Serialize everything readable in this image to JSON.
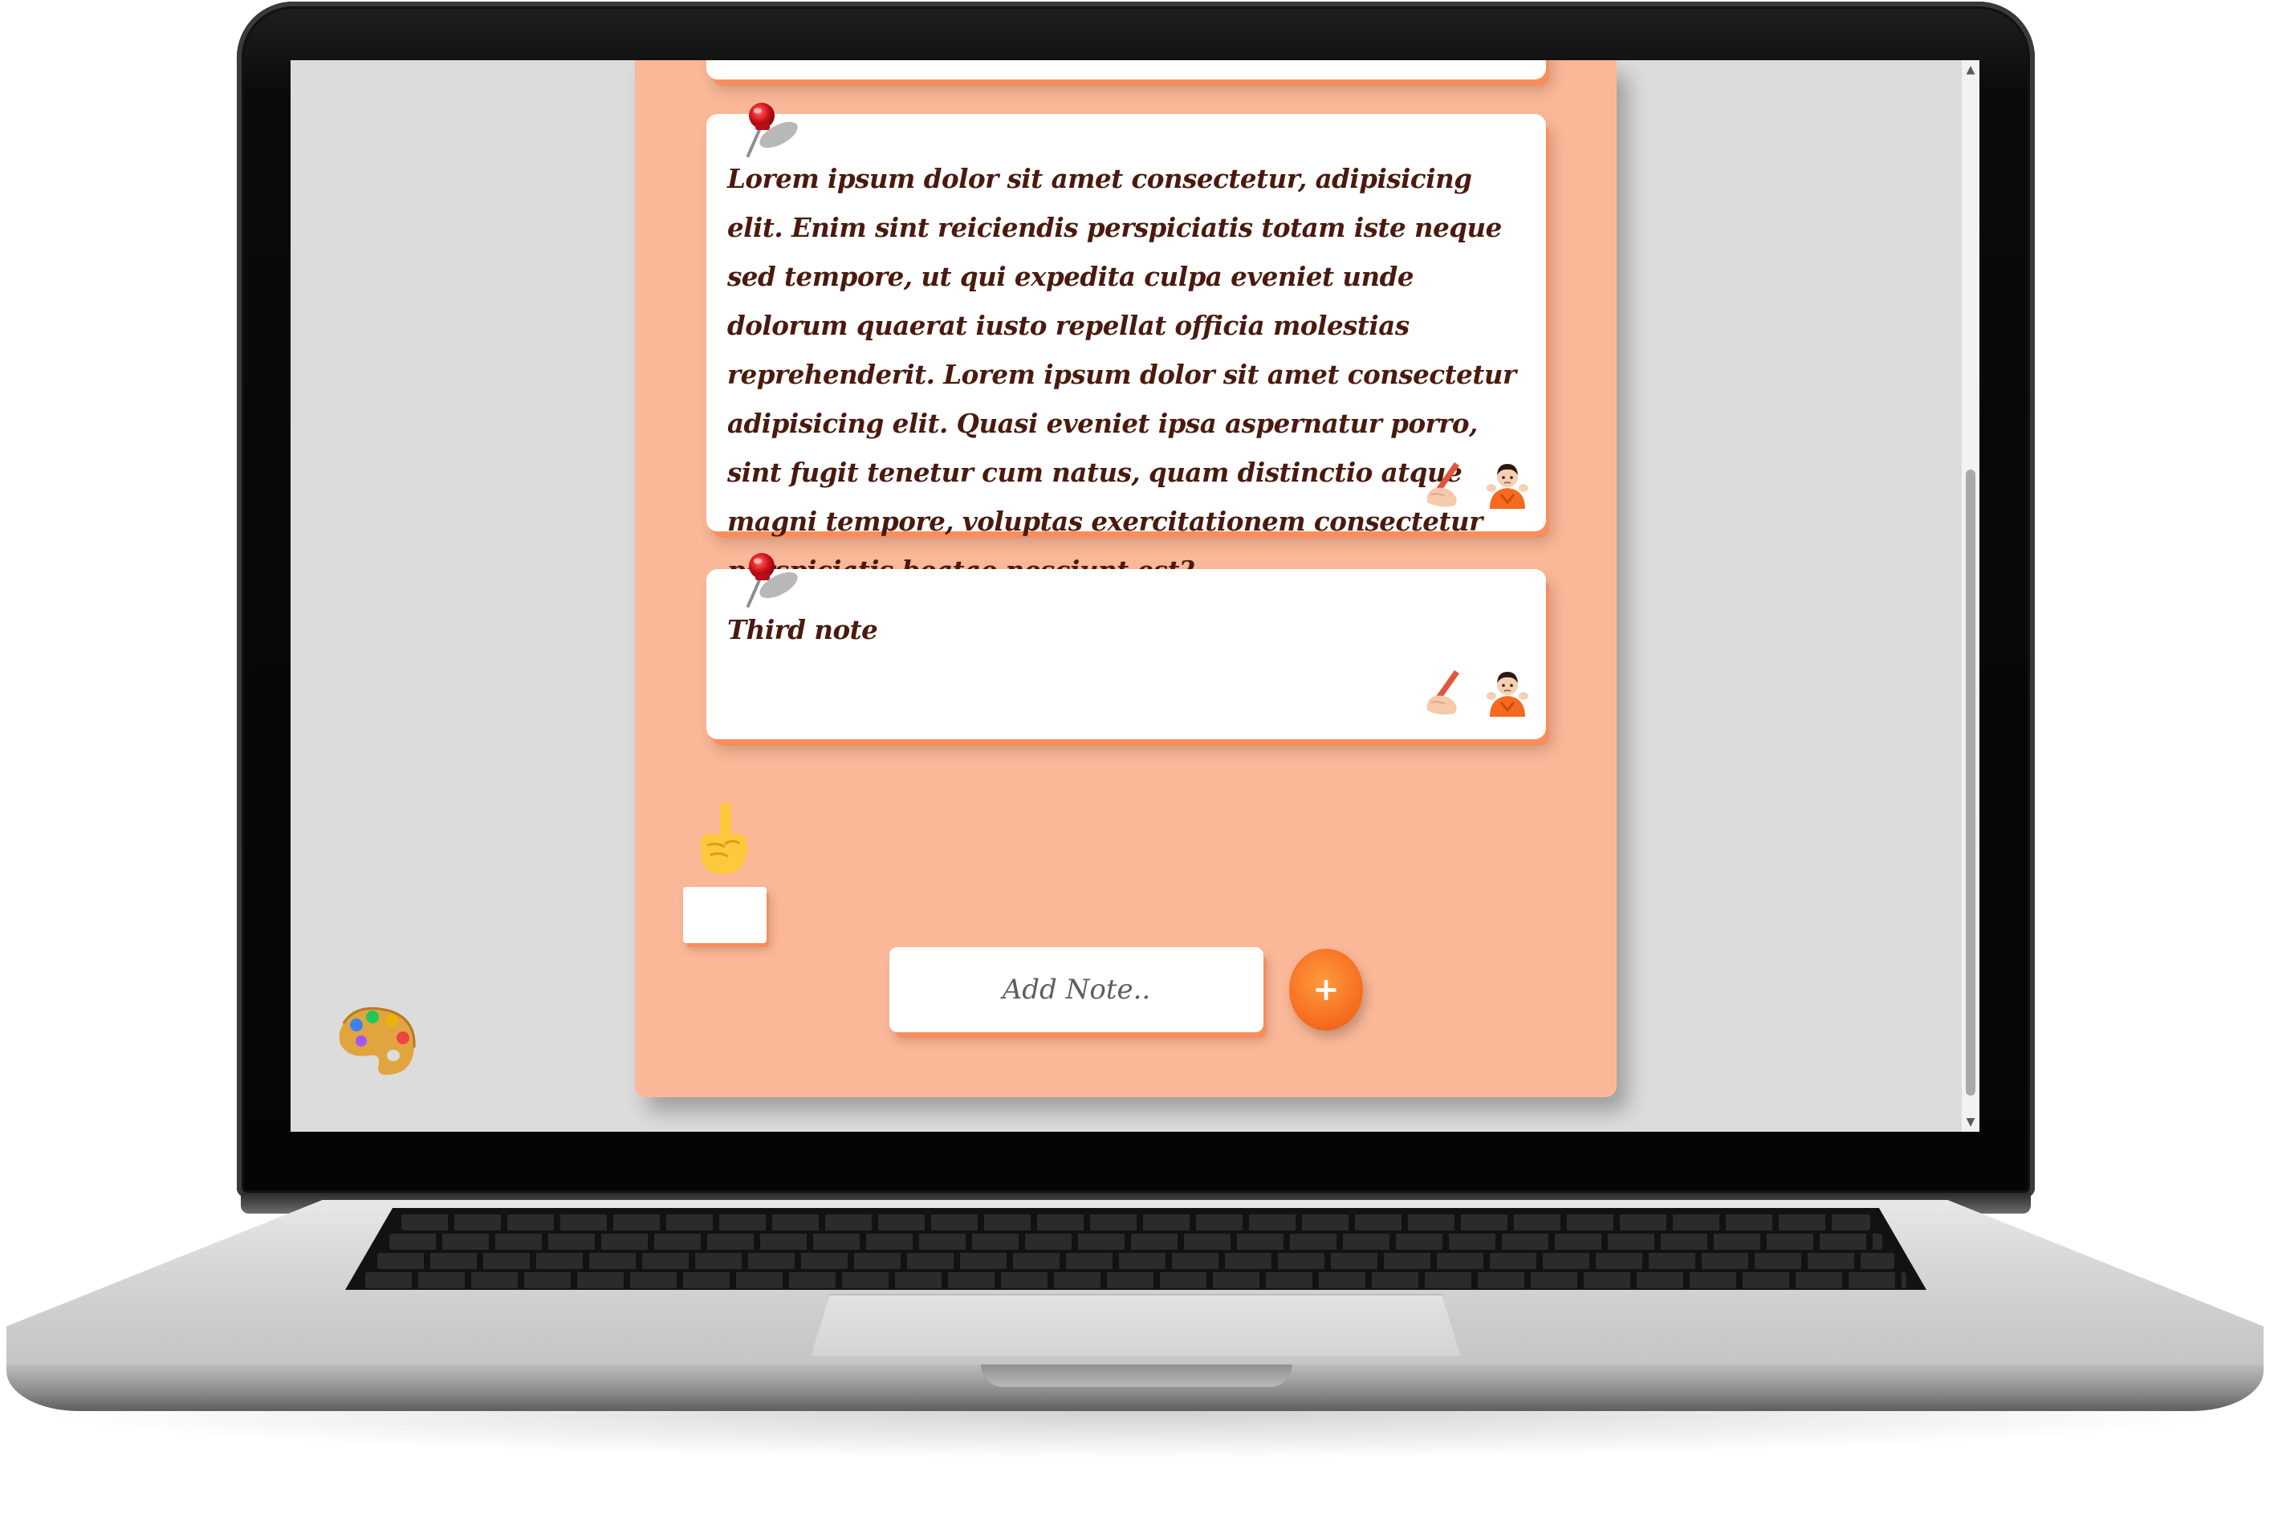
{
  "notes": [
    {
      "text": "Lorem ipsum dolor sit amet consectetur, adipisicing elit. Enim sint reiciendis perspiciatis totam iste neque sed tempore, ut qui expedita culpa eveniet unde dolorum quaerat iusto repellat officia molestias reprehenderit. Lorem ipsum dolor sit amet consectetur adipisicing elit. Quasi eveniet ipsa aspernatur porro, sint fugit tenetur cum natus, quam distinctio atque magni tempore, voluptas exercitationem consectetur perspiciatis beatae nesciunt est?"
    },
    {
      "text": "Third note"
    }
  ],
  "add_note": {
    "placeholder": "Add Note..",
    "button_label": "+"
  },
  "scrollbar": {
    "up_arrow": "▲",
    "down_arrow": "▼"
  },
  "icons": {
    "note_pin": "pushpin-icon",
    "edit": "writing-hand-icon",
    "delete": "shrugging-person-icon",
    "hint": "pointing-up-hand-icon",
    "theme": "artist-palette-icon"
  },
  "colors": {
    "screen_background": "#dcdcdc",
    "panel": "#fbb898",
    "note_card": "#ffffff",
    "note_shadow": "#fa8d5c",
    "note_text": "#4a1a0e",
    "add_button": "#f56a1e"
  }
}
